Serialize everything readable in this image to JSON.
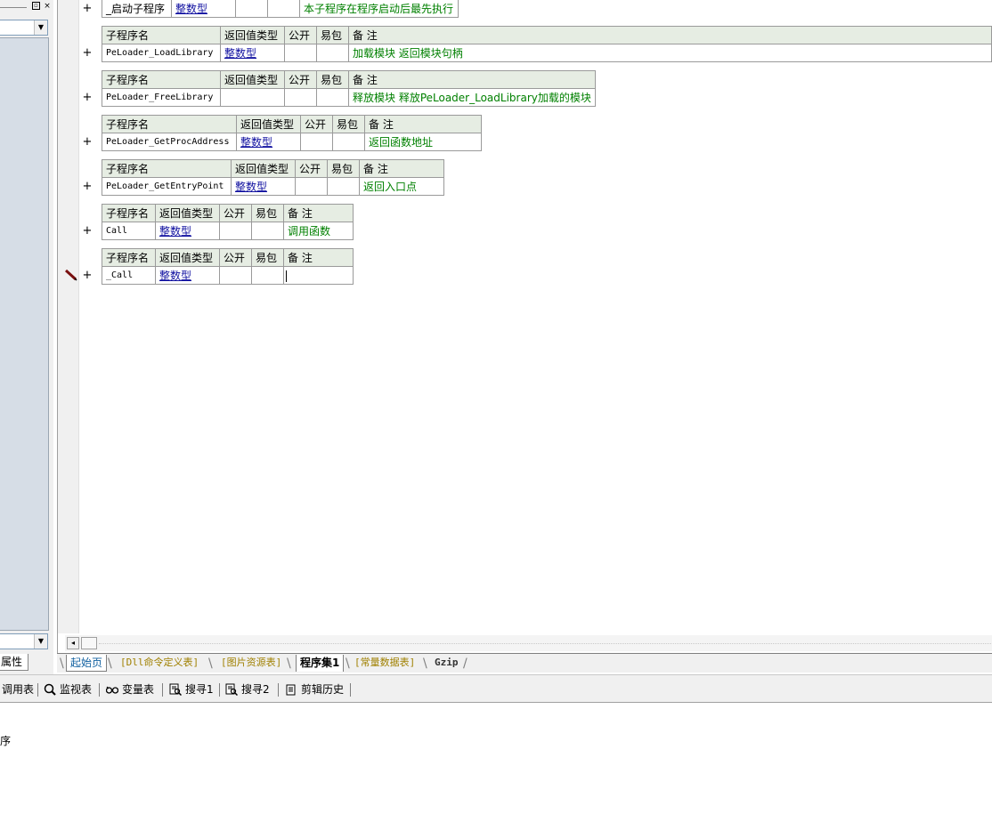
{
  "procs": [
    {
      "name": "_启动子程序",
      "type": "整数型",
      "public": "",
      "easy": "",
      "note": "本子程序在程序启动后最先执行"
    },
    {
      "name": "PeLoader_LoadLibrary",
      "type": "整数型",
      "public": "",
      "easy": "",
      "note": "加载模块 返回模块句柄"
    },
    {
      "name": "PeLoader_FreeLibrary",
      "type": "",
      "public": "",
      "easy": "",
      "note": "释放模块 释放PeLoader_LoadLibrary加载的模块"
    },
    {
      "name": "PeLoader_GetProcAddress",
      "type": "整数型",
      "public": "",
      "easy": "",
      "note": "返回函数地址"
    },
    {
      "name": "PeLoader_GetEntryPoint",
      "type": "整数型",
      "public": "",
      "easy": "",
      "note": "返回入口点"
    },
    {
      "name": "Call",
      "type": "整数型",
      "public": "",
      "easy": "",
      "note": "调用函数"
    },
    {
      "name": "_Call",
      "type": "整数型",
      "public": "",
      "easy": "",
      "note": ""
    }
  ],
  "headers": {
    "name": "子程序名",
    "type": "返回值类型",
    "public": "公开",
    "easy": "易包",
    "note": "备 注"
  },
  "gutter": {
    "expand": "+"
  },
  "left_panel": {
    "prop_tab": "属性",
    "win_btns": [
      "▫",
      "×"
    ],
    "combo_arrow": "▼"
  },
  "tabs": {
    "start": "起始页",
    "dll": "[Dll命令定义表]",
    "images": "[图片资源表]",
    "progset": "程序集1",
    "constants": "[常量数据表]",
    "gzip": "Gzip"
  },
  "toolbar": {
    "calltable": "调用表",
    "watch": "监视表",
    "vars": "变量表",
    "search1": "搜寻1",
    "search2": "搜寻2",
    "cliphist": "剪辑历史"
  },
  "output": {
    "text": "序"
  },
  "scroll": {
    "left": "◂"
  }
}
